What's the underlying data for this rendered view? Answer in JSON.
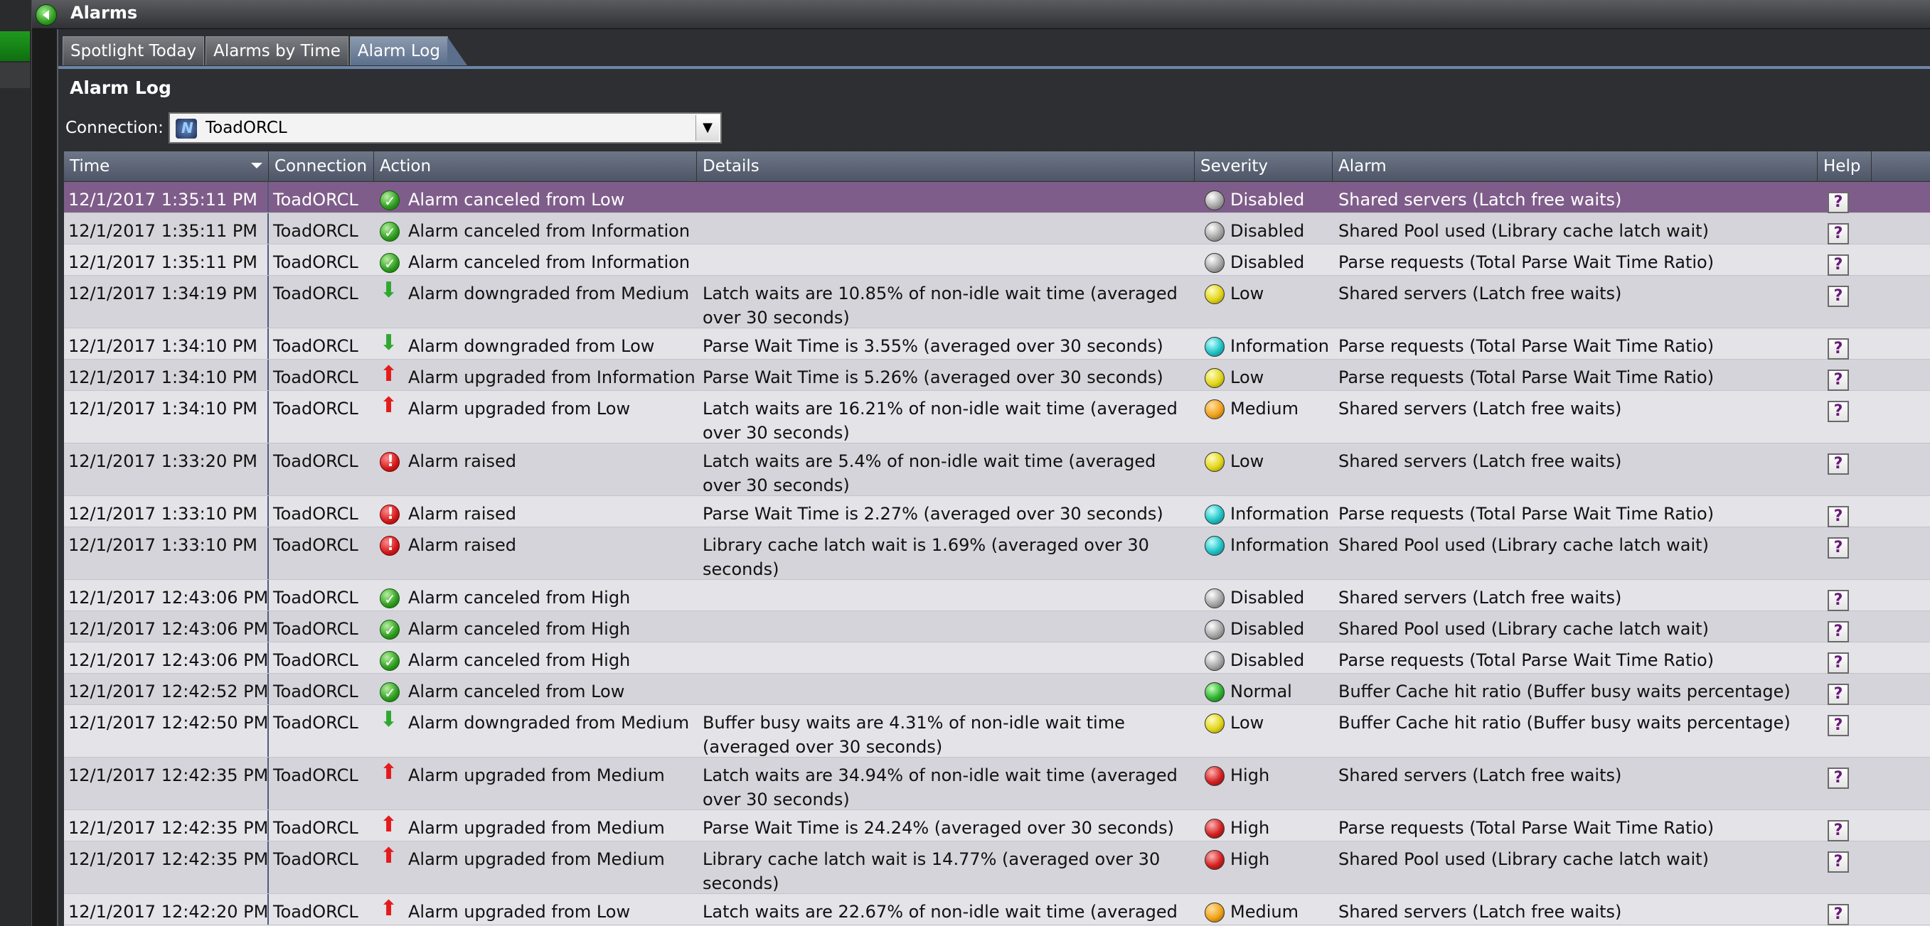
{
  "window": {
    "title": "Alarms"
  },
  "tabs": [
    {
      "label": "Spotlight Today"
    },
    {
      "label": "Alarms by Time"
    },
    {
      "label": "Alarm Log"
    }
  ],
  "section_title": "Alarm Log",
  "connection": {
    "label": "Connection:",
    "value": "ToadORCL"
  },
  "columns": {
    "time": "Time",
    "connection": "Connection",
    "action": "Action",
    "details": "Details",
    "severity": "Severity",
    "alarm": "Alarm",
    "help": "Help"
  },
  "rows": [
    {
      "time": "12/1/2017 1:35:11 PM",
      "connection": "ToadORCL",
      "action_icon": "check-icon",
      "action": "Alarm canceled from Low",
      "details": "",
      "severity_icon": "disabled-icon",
      "severity": "Disabled",
      "alarm": "Shared servers (Latch free waits)",
      "selected": true
    },
    {
      "time": "12/1/2017 1:35:11 PM",
      "connection": "ToadORCL",
      "action_icon": "check-icon",
      "action": "Alarm canceled from Information",
      "details": "",
      "severity_icon": "disabled-icon",
      "severity": "Disabled",
      "alarm": "Shared Pool used (Library cache latch wait)"
    },
    {
      "time": "12/1/2017 1:35:11 PM",
      "connection": "ToadORCL",
      "action_icon": "check-icon",
      "action": "Alarm canceled from Information",
      "details": "",
      "severity_icon": "disabled-icon",
      "severity": "Disabled",
      "alarm": "Parse requests (Total Parse Wait Time Ratio)"
    },
    {
      "time": "12/1/2017 1:34:19 PM",
      "connection": "ToadORCL",
      "action_icon": "arrow-down-icon",
      "action": "Alarm downgraded from Medium",
      "details": "Latch waits are 10.85% of non-idle wait time (averaged over 30 seconds)",
      "severity_icon": "low-icon",
      "severity": "Low",
      "alarm": "Shared servers (Latch free waits)",
      "tall": true
    },
    {
      "time": "12/1/2017 1:34:10 PM",
      "connection": "ToadORCL",
      "action_icon": "arrow-down-icon",
      "action": "Alarm downgraded from Low",
      "details": "Parse Wait Time is 3.55% (averaged over 30 seconds)",
      "severity_icon": "info-icon",
      "severity": "Information",
      "alarm": "Parse requests (Total Parse Wait Time Ratio)"
    },
    {
      "time": "12/1/2017 1:34:10 PM",
      "connection": "ToadORCL",
      "action_icon": "arrow-up-icon",
      "action": "Alarm upgraded from Information",
      "details": "Parse Wait Time is 5.26% (averaged over 30 seconds)",
      "severity_icon": "low-icon",
      "severity": "Low",
      "alarm": "Parse requests (Total Parse Wait Time Ratio)"
    },
    {
      "time": "12/1/2017 1:34:10 PM",
      "connection": "ToadORCL",
      "action_icon": "arrow-up-icon",
      "action": "Alarm upgraded from Low",
      "details": "Latch waits are 16.21% of non-idle wait time (averaged over 30 seconds)",
      "severity_icon": "medium-icon",
      "severity": "Medium",
      "alarm": "Shared servers (Latch free waits)",
      "tall": true
    },
    {
      "time": "12/1/2017 1:33:20 PM",
      "connection": "ToadORCL",
      "action_icon": "raised-icon",
      "action": "Alarm raised",
      "details": "Latch waits are 5.4% of non-idle wait time (averaged over 30 seconds)",
      "severity_icon": "low-icon",
      "severity": "Low",
      "alarm": "Shared servers (Latch free waits)",
      "tall": true
    },
    {
      "time": "12/1/2017 1:33:10 PM",
      "connection": "ToadORCL",
      "action_icon": "raised-icon",
      "action": "Alarm raised",
      "details": "Parse Wait Time is 2.27% (averaged over 30 seconds)",
      "severity_icon": "info-icon",
      "severity": "Information",
      "alarm": "Parse requests (Total Parse Wait Time Ratio)"
    },
    {
      "time": "12/1/2017 1:33:10 PM",
      "connection": "ToadORCL",
      "action_icon": "raised-icon",
      "action": "Alarm raised",
      "details": "Library cache latch wait is 1.69% (averaged over 30 seconds)",
      "severity_icon": "info-icon",
      "severity": "Information",
      "alarm": "Shared Pool used (Library cache latch wait)",
      "tall": true
    },
    {
      "time": "12/1/2017 12:43:06 PM",
      "connection": "ToadORCL",
      "action_icon": "check-icon",
      "action": "Alarm canceled from High",
      "details": "",
      "severity_icon": "disabled-icon",
      "severity": "Disabled",
      "alarm": "Shared servers (Latch free waits)"
    },
    {
      "time": "12/1/2017 12:43:06 PM",
      "connection": "ToadORCL",
      "action_icon": "check-icon",
      "action": "Alarm canceled from High",
      "details": "",
      "severity_icon": "disabled-icon",
      "severity": "Disabled",
      "alarm": "Shared Pool used (Library cache latch wait)"
    },
    {
      "time": "12/1/2017 12:43:06 PM",
      "connection": "ToadORCL",
      "action_icon": "check-icon",
      "action": "Alarm canceled from High",
      "details": "",
      "severity_icon": "disabled-icon",
      "severity": "Disabled",
      "alarm": "Parse requests (Total Parse Wait Time Ratio)"
    },
    {
      "time": "12/1/2017 12:42:52 PM",
      "connection": "ToadORCL",
      "action_icon": "check-icon",
      "action": "Alarm canceled from Low",
      "details": "",
      "severity_icon": "normal-icon",
      "severity": "Normal",
      "alarm": "Buffer Cache hit ratio (Buffer busy waits percentage)"
    },
    {
      "time": "12/1/2017 12:42:50 PM",
      "connection": "ToadORCL",
      "action_icon": "arrow-down-icon",
      "action": "Alarm downgraded from Medium",
      "details": "Buffer busy waits are 4.31% of non-idle wait time (averaged over 30 seconds)",
      "severity_icon": "low-icon",
      "severity": "Low",
      "alarm": "Buffer Cache hit ratio (Buffer busy waits percentage)",
      "tall": true
    },
    {
      "time": "12/1/2017 12:42:35 PM",
      "connection": "ToadORCL",
      "action_icon": "arrow-up-icon",
      "action": "Alarm upgraded from Medium",
      "details": "Latch waits are 34.94% of non-idle wait time (averaged over 30 seconds)",
      "severity_icon": "high-icon",
      "severity": "High",
      "alarm": "Shared servers (Latch free waits)",
      "tall": true
    },
    {
      "time": "12/1/2017 12:42:35 PM",
      "connection": "ToadORCL",
      "action_icon": "arrow-up-icon",
      "action": "Alarm upgraded from Medium",
      "details": "Parse Wait Time is 24.24% (averaged over 30 seconds)",
      "severity_icon": "high-icon",
      "severity": "High",
      "alarm": "Parse requests (Total Parse Wait Time Ratio)"
    },
    {
      "time": "12/1/2017 12:42:35 PM",
      "connection": "ToadORCL",
      "action_icon": "arrow-up-icon",
      "action": "Alarm upgraded from Medium",
      "details": "Library cache latch wait is 14.77% (averaged over 30 seconds)",
      "severity_icon": "high-icon",
      "severity": "High",
      "alarm": "Shared Pool used (Library cache latch wait)",
      "tall": true
    },
    {
      "time": "12/1/2017 12:42:20 PM",
      "connection": "ToadORCL",
      "action_icon": "arrow-up-icon",
      "action": "Alarm upgraded from Low",
      "details": "Latch waits are 22.67% of non-idle wait time (averaged",
      "severity_icon": "medium-icon",
      "severity": "Medium",
      "alarm": "Shared servers (Latch free waits)"
    }
  ],
  "help_label": "?"
}
